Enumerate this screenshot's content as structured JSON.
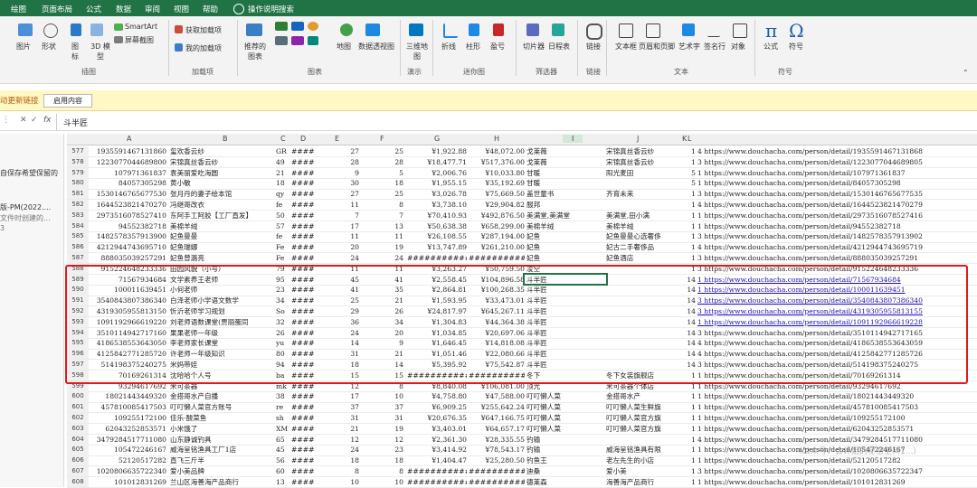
{
  "ribbon_tabs": [
    "绘图",
    "页面布局",
    "公式",
    "数据",
    "审阅",
    "视图",
    "帮助",
    "操作说明搜索"
  ],
  "ribbon_buttons": {
    "picture": "图片",
    "shapes": "形状",
    "icons": "图标",
    "model3d": "3D 模型",
    "smartart": "SmartArt",
    "screenshot": "屏幕截图",
    "get_addins": "获取加载项",
    "my_addins": "我的加载项",
    "rec_charts": "推荐的图表",
    "map": "地图",
    "pivot_chart": "数据透视图",
    "map3d": "三维地图",
    "line": "折线",
    "column": "柱形",
    "winloss": "盈亏",
    "slicer": "切片器",
    "timeline": "日程表",
    "link": "链接",
    "textbox": "文本框",
    "header_footer": "页眉和页脚",
    "wordart": "艺术字",
    "signature": "签名行",
    "object": "对象",
    "equation": "公式",
    "symbol": "符号"
  },
  "ribbon_groups": {
    "illustrations": "插图",
    "addins": "加载项",
    "charts": "图表",
    "tours": "演示",
    "sparklines": "迷你图",
    "filters": "筛选器",
    "links": "链接",
    "text": "文本",
    "symbols": "符号"
  },
  "message_bar": {
    "left": "动更新链接",
    "button": "启用内容"
  },
  "formula_bar": {
    "x": "✕",
    "check": "✓",
    "fx": "fx",
    "value": "斗半匠"
  },
  "side_panel": {
    "l1": "自保存希望保留的",
    "l2": "版-PM(2022....",
    "l3": "文件时创建的...",
    "l4": "3"
  },
  "columns": [
    "A",
    "B",
    "C",
    "D",
    "E",
    "F",
    "G",
    "H",
    "I",
    "J",
    "K",
    "L"
  ],
  "rows": [
    {
      "n": "577",
      "a": "1935591467131860",
      "b": "玺欢香云纱",
      "c": "GR",
      "d": "####",
      "e": "27",
      "f": "25",
      "g": "¥1,922.88",
      "h": "¥48,072.00",
      "i": "戈莱薇",
      "j": "宋锦真丝香云纱",
      "k": "1",
      "l": "4 https://www.douchacha.com/person/detail/1935591467131868",
      "link": false
    },
    {
      "n": "578",
      "a": "1223077044689800",
      "b": "宋锦真丝香云纱",
      "c": "49",
      "d": "####",
      "e": "28",
      "f": "28",
      "g": "¥18,477.71",
      "h": "¥517,376.00",
      "i": "戈莱薇",
      "j": "宋锦真丝香云纱",
      "k": "1",
      "l": "3 https://www.douchacha.com/person/detail/1223077044689805",
      "link": false
    },
    {
      "n": "579",
      "a": "107971361837",
      "b": "袁美丽爱吃海圆",
      "c": "21",
      "d": "####",
      "e": "9",
      "f": "5",
      "g": "¥2,006.76",
      "h": "¥10,033.80",
      "i": "甘暖",
      "j": "阳光麦田",
      "k": "5",
      "l": "1 https://www.douchacha.com/person/detail/107971361837",
      "link": false
    },
    {
      "n": "580",
      "a": "84057305298",
      "b": "黄小敏",
      "c": "18",
      "d": "####",
      "e": "30",
      "f": "18",
      "g": "¥1,955.15",
      "h": "¥35,192.69",
      "i": "甘暖",
      "j": "",
      "k": "5",
      "l": "1 https://www.douchacha.com/person/detail/84057305298",
      "link": false
    },
    {
      "n": "581",
      "a": "1530146765677530",
      "b": "张月丹的妻子绘本馆",
      "c": "qy",
      "d": "####",
      "e": "27",
      "f": "25",
      "g": "¥3,026.78",
      "h": "¥75,669.50",
      "i": "盖世童书",
      "j": "齐育未来",
      "k": "1",
      "l": "3 https://www.douchacha.com/person/detail/1530146765677535",
      "link": false
    },
    {
      "n": "582",
      "a": "1644523821470270",
      "b": "冯继哥改衣",
      "c": "fe",
      "d": "####",
      "e": "11",
      "f": "8",
      "g": "¥3,738.10",
      "h": "¥29,904.82",
      "i": "服邦",
      "j": "",
      "k": "1",
      "l": "4 https://www.douchacha.com/person/detail/1644523821470279",
      "link": false
    },
    {
      "n": "583",
      "a": "2973516078527410",
      "b": "东阿手工阿胶【工厂直发】",
      "c": "50",
      "d": "####",
      "e": "7",
      "f": "7",
      "g": "¥70,410.93",
      "h": "¥492,876.50",
      "i": "美满堂,美满堂",
      "j": "美满堂,田小满",
      "k": "1",
      "l": "1 https://www.douchacha.com/person/detail/2973516078527416",
      "link": false
    },
    {
      "n": "584",
      "a": "94552382718",
      "b": "美棉羊绒",
      "c": "57",
      "d": "####",
      "e": "17",
      "f": "13",
      "g": "¥50,638.38",
      "h": "¥658,299.00",
      "i": "美棉羊绒",
      "j": "美棉羊绒",
      "k": "1",
      "l": "1 https://www.douchacha.com/person/detail/94552382718",
      "link": false
    },
    {
      "n": "585",
      "a": "1482578357913900",
      "b": "妃鱼曼曼",
      "c": "fe",
      "d": "####",
      "e": "11",
      "f": "11",
      "g": "¥26,108.55",
      "h": "¥287,194.00",
      "i": "妃鱼",
      "j": "妃鱼曼曼心选奢侈",
      "k": "1",
      "l": "3 https://www.douchacha.com/person/detail/1482578357913902",
      "link": false
    },
    {
      "n": "586",
      "a": "4212944743695710",
      "b": "妃鱼瑞娜",
      "c": "Fe",
      "d": "####",
      "e": "20",
      "f": "19",
      "g": "¥13,747.89",
      "h": "¥261,210.00",
      "i": "妃鱼",
      "j": "妃古二手奢侈品",
      "k": "1",
      "l": "4 https://www.douchacha.com/person/detail/4212944743695719",
      "link": false
    },
    {
      "n": "587",
      "a": "888035039257291",
      "b": "妃鱼曾潞亮",
      "c": "Fe",
      "d": "####",
      "e": "24",
      "f": "24",
      "g": "###########",
      "h": "###########",
      "i": "妃鱼",
      "j": "妃鱼酒店",
      "k": "1",
      "l": "3 https://www.douchacha.com/person/detail/888035039257291",
      "link": false
    },
    {
      "n": "588",
      "a": "915224648233336",
      "b": "田园风貌（小号）",
      "c": "79",
      "d": "####",
      "e": "11",
      "f": "11",
      "g": "¥3,263.27",
      "h": "¥50,759.50",
      "i": "凌空",
      "j": "",
      "k": "1",
      "l": "3 https://www.douchacha.com/person/detail/915224648233336",
      "link": false
    },
    {
      "n": "589",
      "a": "71567934684",
      "b": "文学素养王老师",
      "c": "95",
      "d": "####",
      "e": "45",
      "f": "41",
      "g": "¥2,558.45",
      "h": "¥104,896.58",
      "i": "斗半匠",
      "j": "",
      "k": "14",
      "l": "1 https://www.douchacha.com/person/detail/71567934684",
      "link": true
    },
    {
      "n": "590",
      "a": "100011639451",
      "b": "小何老师",
      "c": "23",
      "d": "####",
      "e": "41",
      "f": "35",
      "g": "¥2,864.81",
      "h": "¥100,268.35",
      "i": "斗半匠",
      "j": "",
      "k": "14",
      "l": "1 https://www.douchacha.com/person/detail/100011639451",
      "link": true
    },
    {
      "n": "591",
      "a": "3540843807386340",
      "b": "白泽老师小学语文数学",
      "c": "34",
      "d": "####",
      "e": "25",
      "f": "21",
      "g": "¥1,593.95",
      "h": "¥33,473.01",
      "i": "斗半匠",
      "j": "",
      "k": "14",
      "l": "3 https://www.douchacha.com/person/detail/3540843807386340",
      "link": true
    },
    {
      "n": "592",
      "a": "4319305955813150",
      "b": "忻沂老师学习规划",
      "c": "So",
      "d": "####",
      "e": "29",
      "f": "26",
      "g": "¥24,817.97",
      "h": "¥645,267.11",
      "i": "斗半匠",
      "j": "",
      "k": "14",
      "l": "3 https://www.douchacha.com/person/detail/4319305955813155",
      "link": true
    },
    {
      "n": "593",
      "a": "1091192966619220",
      "b": "刘老师语数课堂(贾丽蛋同",
      "c": "32",
      "d": "####",
      "e": "36",
      "f": "34",
      "g": "¥1,304.83",
      "h": "¥44,364.38",
      "i": "斗半匠",
      "j": "",
      "k": "14",
      "l": "1 https://www.douchacha.com/person/detail/1091192966619228",
      "link": true
    },
    {
      "n": "594",
      "a": "3510114942717160",
      "b": "果果老师一年级",
      "c": "26",
      "d": "####",
      "e": "24",
      "f": "20",
      "g": "¥1,034.85",
      "h": "¥20,697.06",
      "i": "斗半匠",
      "j": "",
      "k": "14",
      "l": "3 https://www.douchacha.com/person/detail/3510114942717165",
      "link": false
    },
    {
      "n": "595",
      "a": "4186538553643050",
      "b": "李老师家长课堂",
      "c": "yu",
      "d": "####",
      "e": "14",
      "f": "9",
      "g": "¥1,646.45",
      "h": "¥14,818.08",
      "i": "斗半匠",
      "j": "",
      "k": "14",
      "l": "4 https://www.douchacha.com/person/detail/4186538553643059",
      "link": false
    },
    {
      "n": "596",
      "a": "4125842771285720",
      "b": "许老师一年级知识",
      "c": "80",
      "d": "####",
      "e": "31",
      "f": "21",
      "g": "¥1,051.46",
      "h": "¥22,080.66",
      "i": "斗半匠",
      "j": "",
      "k": "14",
      "l": "4 https://www.douchacha.com/person/detail/4125842771285726",
      "link": false
    },
    {
      "n": "597",
      "a": "514198375240275",
      "b": "米妈带娃",
      "c": "94",
      "d": "####",
      "e": "18",
      "f": "14",
      "g": "¥5,395.92",
      "h": "¥75,542.87",
      "i": "斗半匠",
      "j": "",
      "k": "14",
      "l": "3 https://www.douchacha.com/person/detail/514198375240275",
      "link": false
    },
    {
      "n": "598",
      "a": "70169261314",
      "b": "沈哈哈个人号",
      "c": "ba",
      "d": "####",
      "e": "15",
      "f": "15",
      "g": "###########",
      "h": "###########",
      "i": "冬下",
      "j": "冬下女装旗舰店",
      "k": "1",
      "l": "1 https://www.douchacha.com/person/detail/70169261314",
      "link": false
    },
    {
      "n": "599",
      "a": "93294617692",
      "b": "米可茶器",
      "c": "mk",
      "d": "####",
      "e": "12",
      "f": "8",
      "g": "¥8,840.08",
      "h": "¥106,081.00",
      "i": "顶光",
      "j": "米可茶器个体店",
      "k": "1",
      "l": "1 https://www.douchacha.com/person/detail/93294617692",
      "link": false
    },
    {
      "n": "600",
      "a": "18021443449320",
      "b": "金搭哥水产自播",
      "c": "38",
      "d": "####",
      "e": "17",
      "f": "10",
      "g": "¥4,758.80",
      "h": "¥47,588.00",
      "i": "叮叮懒人菜",
      "j": "金搭哥水产",
      "k": "1",
      "l": "1 https://www.douchacha.com/person/detail/18021443449320",
      "link": false
    },
    {
      "n": "601",
      "a": "457810085417503",
      "b": "叮叮懒人菜官方账号",
      "c": "re",
      "d": "####",
      "e": "37",
      "f": "37",
      "g": "¥6,909.25",
      "h": "¥255,642.24",
      "i": "叮叮懒人菜",
      "j": "叮叮懒人菜生鲜旗",
      "k": "1",
      "l": "1 https://www.douchacha.com/person/detail/457810085417503",
      "link": false
    },
    {
      "n": "602",
      "a": "109255172100",
      "b": "佳乐·酸菜鱼",
      "c": "sh",
      "d": "####",
      "e": "31",
      "f": "31",
      "g": "¥20,676.35",
      "h": "¥647,166.75",
      "i": "叮叮懒人菜",
      "j": "叮叮懒人菜官方旗",
      "k": "1",
      "l": "1 https://www.douchacha.com/person/detail/109255172100",
      "link": false
    },
    {
      "n": "603",
      "a": "62043252853571",
      "b": "小米饿了",
      "c": "XM",
      "d": "####",
      "e": "21",
      "f": "19",
      "g": "¥3,403.01",
      "h": "¥64,657.17",
      "i": "叮叮懒人菜",
      "j": "叮叮懒人菜官方旗",
      "k": "1",
      "l": "1 https://www.douchacha.com/person/detail/62043252853571",
      "link": false
    },
    {
      "n": "604",
      "a": "3479284517711080",
      "b": "山东静诚钓具",
      "c": "65",
      "d": "####",
      "e": "12",
      "f": "12",
      "g": "¥2,361.30",
      "h": "¥28,335.55",
      "i": "钓输",
      "j": "",
      "k": "1",
      "l": "4 https://www.douchacha.com/person/detail/3479284517711080",
      "link": false
    },
    {
      "n": "605",
      "a": "105472246167",
      "b": "威海呈铭渔具工厂1店",
      "c": "45",
      "d": "####",
      "e": "24",
      "f": "23",
      "g": "¥3,414.92",
      "h": "¥78,543.17",
      "i": "钓输",
      "j": "威海呈铭渔具有限",
      "k": "1",
      "l": "1 https://www.douchacha.com/person/detail/105472246167",
      "link": false
    },
    {
      "n": "606",
      "a": "52120517282",
      "b": "直飞三斤半",
      "c": "56",
      "d": "####",
      "e": "18",
      "f": "18",
      "g": "¥1,404.47",
      "h": "¥25,280.50",
      "i": "钓鱼王",
      "j": "老左先生的小店",
      "k": "1",
      "l": "1 https://www.douchacha.com/person/detail/52120517282",
      "link": false
    },
    {
      "n": "607",
      "a": "1020806635722340",
      "b": "爱小美品牌",
      "c": "60",
      "d": "####",
      "e": "8",
      "f": "8",
      "g": "###########",
      "h": "###########",
      "i": "迪桑",
      "j": "爱小美",
      "k": "1",
      "l": "3 https://www.douchacha.com/person/detail/1020806635722347",
      "link": false
    },
    {
      "n": "608",
      "a": "101012831269",
      "b": "兰山区海善海产品商行",
      "c": "13",
      "d": "####",
      "e": "10",
      "f": "10",
      "g": "###########",
      "h": "###########",
      "i": "德莱森",
      "j": "海善海产品商行",
      "k": "1",
      "l": "1 https://www.douchacha.com/person/detail/101012831269",
      "link": false
    }
  ],
  "watermark": "（公众号：会计姐的秘密空间1...）"
}
